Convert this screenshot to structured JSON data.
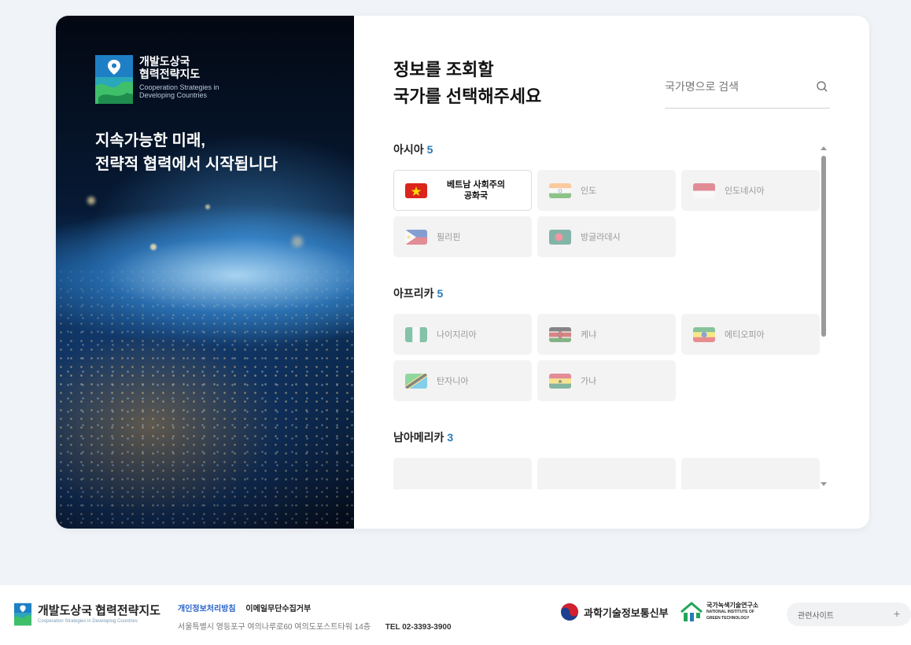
{
  "brand": {
    "name_ko": "개발도상국\n협력전략지도",
    "name_en": "Cooperation Strategies in\nDeveloping Countries"
  },
  "hero": {
    "title": "지속가능한 미래,\n전략적 협력에서 시작됩니다"
  },
  "panel": {
    "title": "정보를 조회할\n국가를 선택해주세요",
    "search_placeholder": "국가명으로 검색"
  },
  "regions": [
    {
      "name": "아시아",
      "count": "5",
      "countries": [
        {
          "label": "베트남 사회주의\n공화국",
          "flag": "vietnam-flag",
          "active": true
        },
        {
          "label": "인도",
          "flag": "india-flag"
        },
        {
          "label": "인도네시아",
          "flag": "indonesia-flag"
        },
        {
          "label": "필리핀",
          "flag": "philippines-flag"
        },
        {
          "label": "방글라데시",
          "flag": "bangladesh-flag"
        }
      ]
    },
    {
      "name": "아프리카",
      "count": "5",
      "countries": [
        {
          "label": "나이지리아",
          "flag": "nigeria-flag"
        },
        {
          "label": "케냐",
          "flag": "kenya-flag"
        },
        {
          "label": "에티오피아",
          "flag": "ethiopia-flag"
        },
        {
          "label": "탄자니아",
          "flag": "tanzania-flag"
        },
        {
          "label": "가나",
          "flag": "ghana-flag"
        }
      ]
    },
    {
      "name": "남아메리카",
      "count": "3",
      "countries": []
    }
  ],
  "footer": {
    "brand_ko": "개발도상국 협력전략지도",
    "brand_en": "Cooperation Strategies in Developing Countries",
    "privacy": "개인정보처리방침",
    "email_policy": "이메일무단수집거부",
    "address": "서울특별시 영등포구 여의나루로60 여의도포스트타워 14층",
    "tel": "TEL 02-3393-3900",
    "ministry": "과학기술정보통신부",
    "institute_ko": "국가녹색기술연구소",
    "institute_en_1": "NATIONAL INSTITUTE OF",
    "institute_en_2": "GREEN TECHNOLOGY",
    "related_sites": "관련사이트",
    "plus": "+"
  },
  "colors": {
    "accent": "#2a7ab8",
    "privacy_link": "#2a62c9",
    "chip_bg": "#f3f3f3"
  }
}
